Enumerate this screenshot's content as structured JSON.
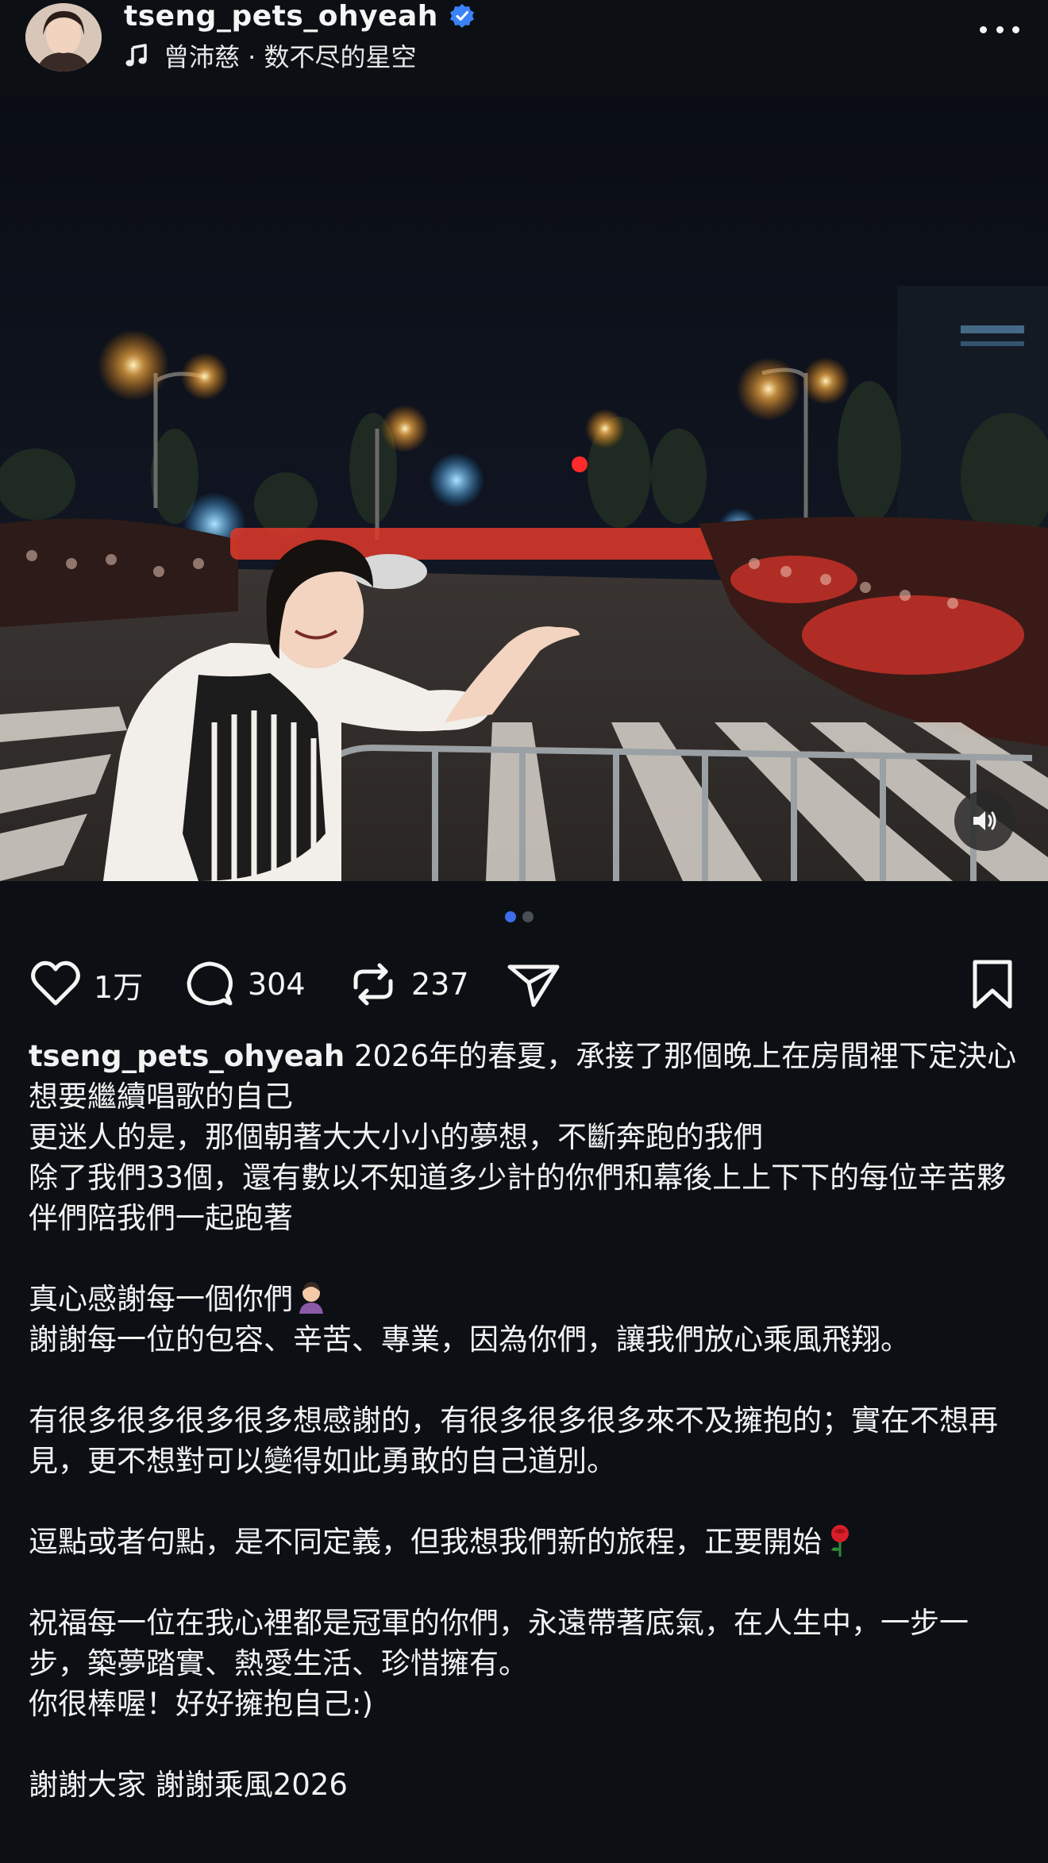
{
  "header": {
    "username": "tseng_pets_ohyeah",
    "music": "曾沛慈 · 数不尽的星空"
  },
  "actions": {
    "likes": "1万",
    "comments": "304",
    "reposts": "237"
  },
  "caption": {
    "author": "tseng_pets_ohyeah",
    "paragraphs": [
      "2026年的春夏，承接了那個晚上在房間裡下定決心想要繼續唱歌的自己",
      "更迷人的是，那個朝著大大小小的夢想，不斷奔跑的我們",
      "除了我們33個，還有數以不知道多少計的你們和幕後上上下下的每位辛苦夥伴們陪我們一起跑著",
      "",
      "真心感謝每一個你們",
      "謝謝每一位的包容、辛苦、專業，因為你們，讓我們放心乘風飛翔。",
      "",
      "有很多很多很多很多想感謝的，有很多很多很多來不及擁抱的；實在不想再見，更不想對可以變得如此勇敢的自己道別。",
      "",
      "逗點或者句點，是不同定義，但我想我們新的旅程，正要開始",
      "",
      "祝福每一位在我心裡都是冠軍的你們，永遠帶著底氣，在人生中，一步一步，築夢踏實、熱愛生活、珍惜擁有。",
      "你很棒喔！好好擁抱自己:)",
      "",
      "謝謝大家 謝謝乘風2026"
    ]
  },
  "carousel": {
    "active": 1,
    "total": 2
  },
  "colors": {
    "background": "#0c1014",
    "accent": "#3d6dea",
    "verified": "#3b82f6"
  },
  "icons": [
    "verified-icon",
    "music-note-icon",
    "more-icon",
    "heart-icon",
    "comment-icon",
    "repost-icon",
    "send-icon",
    "bookmark-icon",
    "volume-icon"
  ]
}
